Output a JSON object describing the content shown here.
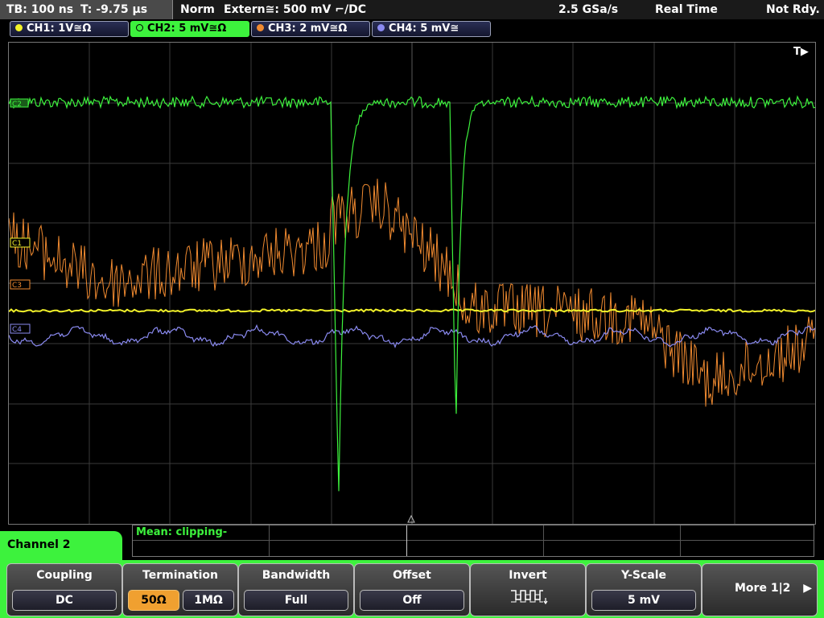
{
  "status": {
    "timebase": "TB: 100 ns",
    "trigger_time": "T: -9.75 µs",
    "mode": "Norm",
    "trigger": "Extern≅: 500 mV ⌐/DC",
    "sample_rate": "2.5 GSa/s",
    "acq_mode": "Real Time",
    "trigger_state": "Not Rdy."
  },
  "channels": [
    {
      "label": "CH1: 1V≅Ω",
      "color": "#f2f22a"
    },
    {
      "label": "CH2: 5 mV≅Ω",
      "color": "#3df23d"
    },
    {
      "label": "CH3: 2 mV≅Ω",
      "color": "#f08a30"
    },
    {
      "label": "CH4: 5 mV≅",
      "color": "#8a8af0"
    }
  ],
  "markers": {
    "c1": "C1",
    "c2": "C2",
    "c3": "C3",
    "c4": "C4",
    "trigger_pos": "T▶"
  },
  "measurement": {
    "label": "Mean: clipping-"
  },
  "menu": {
    "title": "Channel 2",
    "coupling": {
      "title": "Coupling",
      "value": "DC"
    },
    "termination": {
      "title": "Termination",
      "opt1": "50Ω",
      "opt2": "1MΩ"
    },
    "bandwidth": {
      "title": "Bandwidth",
      "value": "Full"
    },
    "offset": {
      "title": "Offset",
      "value": "Off"
    },
    "invert": {
      "title": "Invert",
      "icon": "inverted-square-wave-icon"
    },
    "yscale": {
      "title": "Y-Scale",
      "value": "5 mV"
    },
    "more": {
      "label": "More 1|2"
    }
  }
}
